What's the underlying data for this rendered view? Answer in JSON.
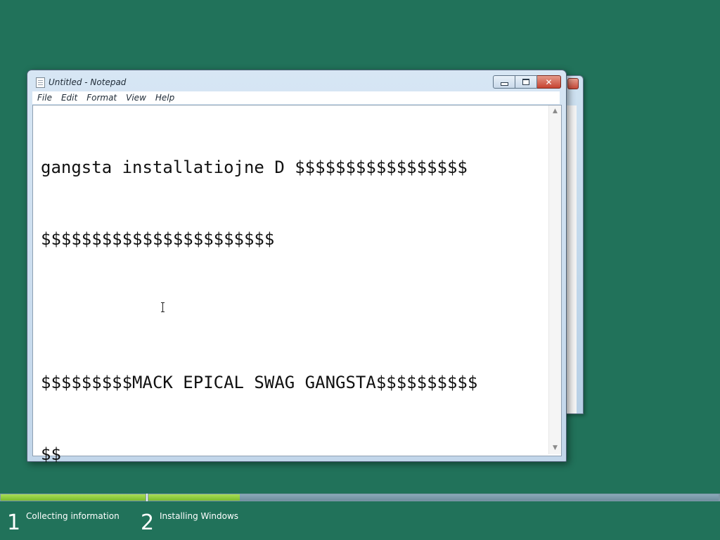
{
  "notepad": {
    "title": "Untitled - Notepad",
    "menu": [
      "File",
      "Edit",
      "Format",
      "View",
      "Help"
    ],
    "text_lines": [
      "gangsta installatiojne D $$$$$$$$$$$$$$$$$",
      "$$$$$$$$$$$$$$$$$$$$$$$",
      "",
      "$$$$$$$$$MACK EPICAL SWAG GANGSTA$$$$$$$$$$",
      "$$"
    ],
    "caption_buttons": {
      "minimize": "minimize-icon",
      "maximize": "maximize-icon",
      "close": "close-icon"
    }
  },
  "setup": {
    "steps": [
      {
        "number": "1",
        "label": "Collecting information"
      },
      {
        "number": "2",
        "label": "Installing Windows"
      }
    ],
    "progress": {
      "step1_fraction": 1.0,
      "step2_fraction": 0.16
    },
    "colors": {
      "background": "#21725a",
      "progress_fill": "#8cc63f",
      "progress_track": "#7e99a8"
    }
  }
}
